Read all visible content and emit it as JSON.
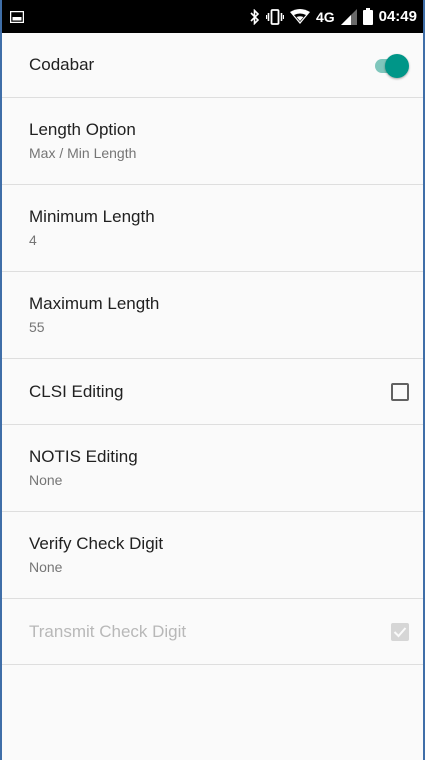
{
  "status_bar": {
    "time": "04:49",
    "network": "4G",
    "icons": [
      "screenshot-icon",
      "bluetooth-icon",
      "vibrate-icon",
      "wifi-icon",
      "signal-icon",
      "battery-icon"
    ]
  },
  "settings": [
    {
      "title": "Codabar",
      "control": "switch",
      "state": "on"
    },
    {
      "title": "Length Option",
      "subtitle": "Max / Min Length"
    },
    {
      "title": "Minimum Length",
      "subtitle": "4"
    },
    {
      "title": "Maximum Length",
      "subtitle": "55"
    },
    {
      "title": "CLSI Editing",
      "control": "checkbox",
      "state": "unchecked"
    },
    {
      "title": "NOTIS Editing",
      "subtitle": "None"
    },
    {
      "title": "Verify Check Digit",
      "subtitle": "None"
    },
    {
      "title": "Transmit Check Digit",
      "control": "checkbox",
      "state": "checked",
      "enabled": false
    }
  ],
  "colors": {
    "accent": "#009688",
    "accent_track": "#7fc6bc",
    "divider": "#dedede",
    "background": "#fafafa",
    "frame_border": "#3f6ea8"
  }
}
